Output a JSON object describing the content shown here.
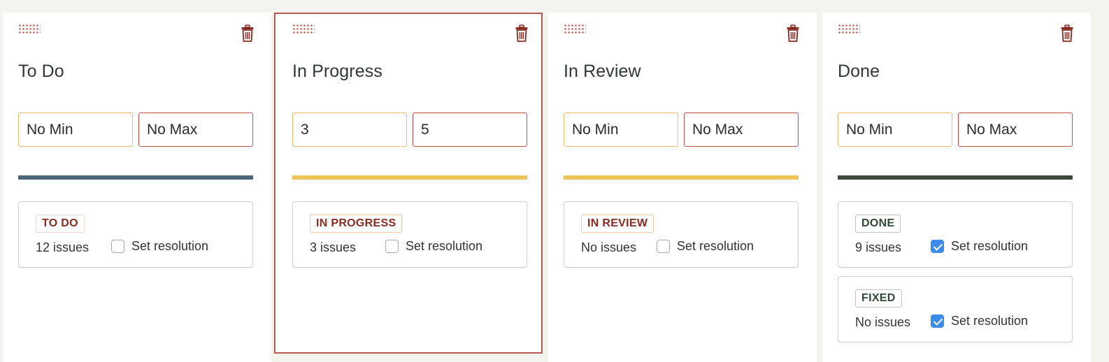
{
  "columns": [
    {
      "id": "todo",
      "title": "To Do",
      "min": "",
      "max": "",
      "min_placeholder": "No Min",
      "max_placeholder": "No Max",
      "bar_color": "#4a6478",
      "selected": false,
      "statuses": [
        {
          "name": "TO DO",
          "issues": "12 issues",
          "resolution_label": "Set resolution",
          "resolution_checked": false,
          "badge_color": "#8a2b22",
          "badge_border": "#f3d6d2"
        }
      ]
    },
    {
      "id": "in-progress",
      "title": "In Progress",
      "min": "3",
      "max": "5",
      "min_placeholder": "No Min",
      "max_placeholder": "No Max",
      "bar_color": "#edc35a",
      "selected": true,
      "statuses": [
        {
          "name": "IN PROGRESS",
          "issues": "3 issues",
          "resolution_label": "Set resolution",
          "resolution_checked": false,
          "badge_color": "#8a2b22",
          "badge_border": "#f5c9a8"
        }
      ]
    },
    {
      "id": "in-review",
      "title": "In Review",
      "min": "",
      "max": "",
      "min_placeholder": "No Min",
      "max_placeholder": "No Max",
      "bar_color": "#edc35a",
      "selected": false,
      "statuses": [
        {
          "name": "IN REVIEW",
          "issues": "No issues",
          "resolution_label": "Set resolution",
          "resolution_checked": false,
          "badge_color": "#8a2b22",
          "badge_border": "#f5c9a8"
        }
      ]
    },
    {
      "id": "done",
      "title": "Done",
      "min": "",
      "max": "",
      "min_placeholder": "No Min",
      "max_placeholder": "No Max",
      "bar_color": "#3a4b3c",
      "selected": false,
      "statuses": [
        {
          "name": "DONE",
          "issues": "9 issues",
          "resolution_label": "Set resolution",
          "resolution_checked": true,
          "badge_color": "#2e4a34",
          "badge_border": "#b9c4bb"
        },
        {
          "name": "FIXED",
          "issues": "No issues",
          "resolution_label": "Set resolution",
          "resolution_checked": true,
          "badge_color": "#2e4a34",
          "badge_border": "#b9c4bb"
        }
      ]
    }
  ],
  "icons": {
    "drag": "drag-handle-icon",
    "delete": "trash-icon"
  },
  "colors": {
    "accent_red": "#b8564f",
    "checkbox_blue": "#3d8be8"
  }
}
